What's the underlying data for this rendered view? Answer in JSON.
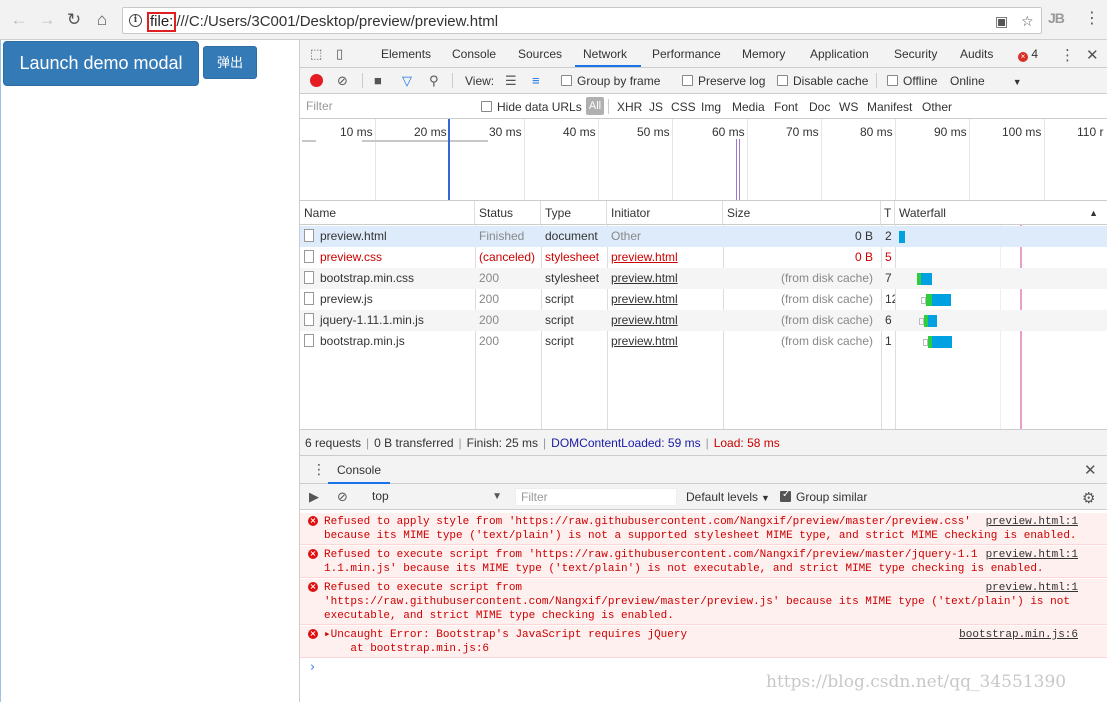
{
  "browser": {
    "url_scheme": "file:",
    "url_rest": "///C:/Users/3C001/Desktop/preview/preview.html",
    "ext_label": "JB"
  },
  "page": {
    "launch_button": "Launch demo modal",
    "popup_button": "弹出"
  },
  "devtools": {
    "tabs": [
      "Elements",
      "Console",
      "Sources",
      "Network",
      "Performance",
      "Memory",
      "Application",
      "Security",
      "Audits"
    ],
    "error_count": "4",
    "toolbar": {
      "view_label": "View:",
      "group_by_frame": "Group by frame",
      "preserve_log": "Preserve log",
      "disable_cache": "Disable cache",
      "offline": "Offline",
      "throttle": "Online"
    },
    "filter": {
      "placeholder": "Filter",
      "hide_data_urls": "Hide data URLs",
      "all": "All",
      "types": [
        "XHR",
        "JS",
        "CSS",
        "Img",
        "Media",
        "Font",
        "Doc",
        "WS",
        "Manifest",
        "Other"
      ]
    },
    "overview_ticks": [
      "10 ms",
      "20 ms",
      "30 ms",
      "40 ms",
      "50 ms",
      "60 ms",
      "70 ms",
      "80 ms",
      "90 ms",
      "100 ms",
      "110 r"
    ],
    "table": {
      "headers": {
        "name": "Name",
        "status": "Status",
        "type": "Type",
        "initiator": "Initiator",
        "size": "Size",
        "time": "T",
        "waterfall": "Waterfall"
      },
      "rows": [
        {
          "name": "preview.html",
          "status": "Finished",
          "type": "document",
          "initiator": "Other",
          "size": "0 B",
          "time": "2"
        },
        {
          "name": "preview.css",
          "status": "(canceled)",
          "type": "stylesheet",
          "initiator": "preview.html",
          "size": "0 B",
          "time": "5"
        },
        {
          "name": "bootstrap.min.css",
          "status": "200",
          "type": "stylesheet",
          "initiator": "preview.html",
          "size": "(from disk cache)",
          "time": "7"
        },
        {
          "name": "preview.js",
          "status": "200",
          "type": "script",
          "initiator": "preview.html",
          "size": "(from disk cache)",
          "time": "12"
        },
        {
          "name": "jquery-1.11.1.min.js",
          "status": "200",
          "type": "script",
          "initiator": "preview.html",
          "size": "(from disk cache)",
          "time": "6"
        },
        {
          "name": "bootstrap.min.js",
          "status": "200",
          "type": "script",
          "initiator": "preview.html",
          "size": "(from disk cache)",
          "time": "1"
        }
      ]
    },
    "summary": {
      "requests": "6 requests",
      "transferred": "0 B transferred",
      "finish": "Finish: 25 ms",
      "dcl": "DOMContentLoaded: 59 ms",
      "load": "Load: 58 ms"
    },
    "console": {
      "tab": "Console",
      "context": "top",
      "filter_placeholder": "Filter",
      "levels": "Default levels",
      "group_similar": "Group similar",
      "messages": [
        {
          "text": "Refused to apply style from 'https://raw.githubusercontent.com/Nangxif/preview/master/preview.css'\nbecause its MIME type ('text/plain') is not a supported stylesheet MIME type, and strict MIME checking is enabled.",
          "source": "preview.html:1"
        },
        {
          "text": "Refused to execute script from 'https://raw.githubusercontent.com/Nangxif/preview/master/jquery-1.1\n1.1.min.js' because its MIME type ('text/plain') is not executable, and strict MIME type checking is enabled.",
          "source": "preview.html:1"
        },
        {
          "text": "Refused to execute script from\n'https://raw.githubusercontent.com/Nangxif/preview/master/preview.js' because its MIME type ('text/plain') is not\nexecutable, and strict MIME type checking is enabled.",
          "source": "preview.html:1"
        },
        {
          "text": "▸Uncaught Error: Bootstrap's JavaScript requires jQuery\n    at bootstrap.min.js:6",
          "source": "bootstrap.min.js:6"
        }
      ],
      "prompt": "›"
    }
  },
  "watermark": "https://blog.csdn.net/qq_34551390"
}
